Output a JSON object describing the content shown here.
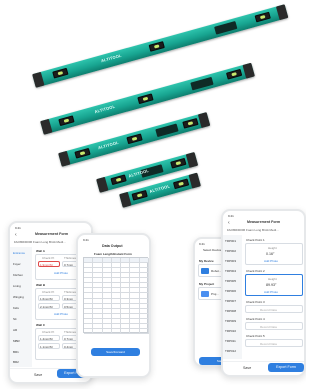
{
  "product": {
    "brand": "ALTiTOOL"
  },
  "phone1": {
    "time": "9:41",
    "title": "Measurement Form",
    "project": "FAO80D0006 Foam Long Brick Medi...",
    "sidebar": [
      "Entrance",
      "Foyer",
      "Kitchen",
      "Living",
      "Winging",
      "Kids",
      "Sit",
      "AR",
      "MBR",
      "BR1",
      "BR2"
    ],
    "sections": [
      {
        "name": "Wall A",
        "cols": [
          "Check Pt",
          "Thickness"
        ],
        "v1": "1.9mm/M",
        "v2": "0.7mm",
        "highlight": true
      },
      {
        "name": "Wall B",
        "cols": [
          "Check Pt",
          "Thickness"
        ],
        "v1": "1.6mm/M",
        "v2": "0.3mm",
        "v3": "2.1mm/M",
        "v4": "0.5mm"
      },
      {
        "name": "Wall C",
        "cols": [
          "Check Pt",
          "Thickness"
        ],
        "v1": "1.4mm/M",
        "v2": "0.7mm",
        "v3": "1.1mm/M",
        "v4": "0.4mm"
      }
    ],
    "add_photo": "Add Photo",
    "save": "Save",
    "submit": "Export Form"
  },
  "phone2": {
    "time": "9:41",
    "title": "Data Output",
    "table_title": "Foam Length/Instant Form",
    "share": "Save/Forward"
  },
  "phone3": {
    "time": "9:41",
    "header": "Select Device",
    "devices_label": "My Device",
    "device_name": "Robot...",
    "projects_label": "My Project",
    "project_name": "Proj...",
    "button": "Start"
  },
  "phone4": {
    "time": "9:41",
    "title": "Measurement Form",
    "project": "FAO80D0006 Foam Long Brick Medi...",
    "left": [
      "TRP001",
      "TRP002",
      "TRP003",
      "TRP004",
      "TRP005",
      "TRP006",
      "TRP007",
      "TRP008",
      "TRP009",
      "TRP010",
      "TRP011",
      "TRP012"
    ],
    "p1": {
      "label": "Check Point 1",
      "field": "Height",
      "value": "0.16°"
    },
    "p2": {
      "label": "Check Point 2",
      "field": "Height",
      "value": "89.93°"
    },
    "p3": {
      "label": "Check Point 3",
      "placeholder": "Record Data"
    },
    "p4": {
      "label": "Check Point 4",
      "placeholder": "Record Data"
    },
    "p5": {
      "label": "Check Point 5",
      "placeholder": "Record Data"
    },
    "add_photo": "Add Photo",
    "save": "Save",
    "submit": "Export Form"
  }
}
